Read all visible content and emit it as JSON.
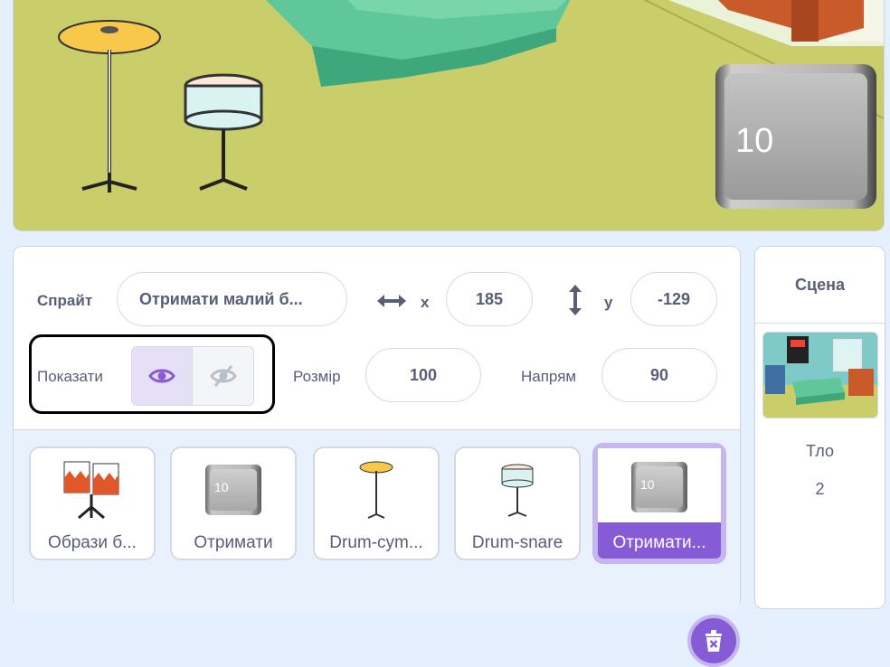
{
  "stage": {
    "sprite_counter": "10"
  },
  "sprite_info": {
    "sprite_label": "Спрайт",
    "sprite_name": "Отримати малий б...",
    "x_label": "x",
    "x_value": "185",
    "y_label": "y",
    "y_value": "-129",
    "show_label": "Показати",
    "size_label": "Розмір",
    "size_value": "100",
    "direction_label": "Напрям",
    "direction_value": "90"
  },
  "sprites": [
    {
      "name": "Образи б...",
      "thumb": "conga-drums"
    },
    {
      "name": "Отримати",
      "thumb": "counter-10",
      "counter": "10"
    },
    {
      "name": "Drum-cym...",
      "thumb": "cymbal"
    },
    {
      "name": "Drum-snare",
      "thumb": "snare-drum"
    },
    {
      "name": "Отримати...",
      "thumb": "counter-10",
      "counter": "10",
      "selected": true
    }
  ],
  "stage_panel": {
    "title": "Сцена",
    "backdrop_label": "Тло",
    "backdrop_count": "2"
  },
  "colors": {
    "accent": "#855cd6",
    "accent_light": "#c5b5f0",
    "text": "#575e75",
    "background": "#e5f0ff"
  }
}
